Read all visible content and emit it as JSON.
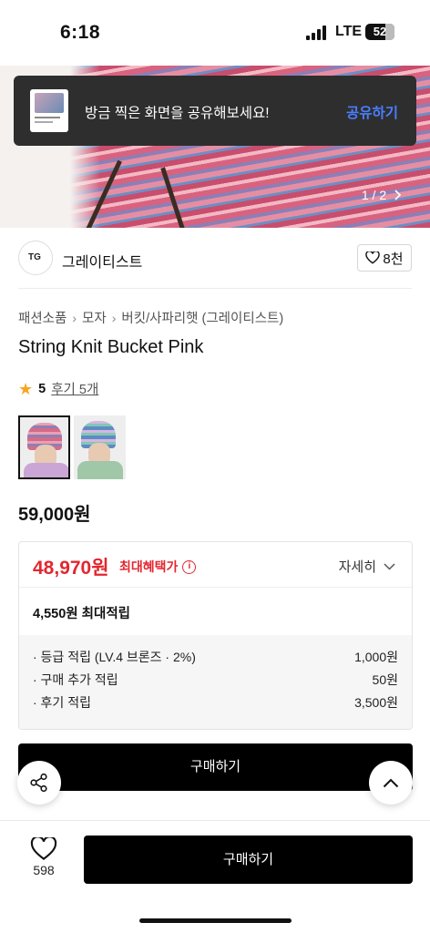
{
  "status_bar": {
    "time": "6:18",
    "network": "LTE",
    "battery": "52"
  },
  "toast": {
    "message": "방금 찍은 화면을 공유해보세요!",
    "action": "공유하기"
  },
  "hero": {
    "counter": "1 / 2"
  },
  "brand": {
    "name": "그레이티스트",
    "likes": "8천"
  },
  "breadcrumb": [
    "패션소품",
    "모자",
    "버킷/사파리햇 (그레이티스트)"
  ],
  "product": {
    "title": "String Knit Bucket Pink",
    "rating": "5",
    "reviews": "후기 5개",
    "price": "59,000원"
  },
  "benefit": {
    "sale_price": "48,970원",
    "sale_label": "최대혜택가",
    "detail_label": "자세히",
    "points_total": "4,550원 최대적립",
    "breakdown": [
      {
        "label": "· 등급 적립 (LV.4 브론즈 · 2%)",
        "value": "1,000원"
      },
      {
        "label": "· 구매 추가 적립",
        "value": "50원"
      },
      {
        "label": "· 후기 적립",
        "value": "3,500원"
      }
    ]
  },
  "buttons": {
    "buy_inline": "구매하기",
    "buy_bottom": "구매하기"
  },
  "bottom": {
    "like_count": "598"
  },
  "colors": {
    "accent_red": "#e4262f",
    "link_blue": "#4a7dff",
    "star": "#f5a623"
  }
}
